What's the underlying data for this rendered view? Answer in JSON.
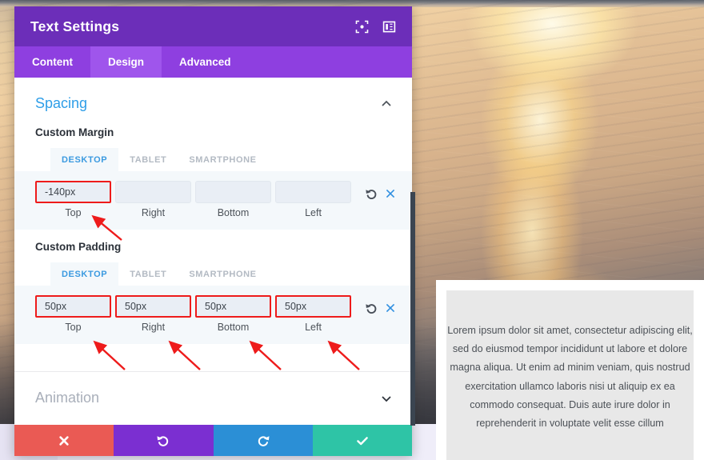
{
  "modal": {
    "title": "Text Settings",
    "header_icons": [
      {
        "name": "focus-target-icon"
      },
      {
        "name": "panel-layout-icon"
      }
    ],
    "tabs": [
      {
        "label": "Content",
        "active": false
      },
      {
        "label": "Design",
        "active": true
      },
      {
        "label": "Advanced",
        "active": false
      }
    ],
    "sections": [
      {
        "title": "Spacing",
        "expanded": true,
        "chevron": "chevron-up-icon",
        "groups": [
          {
            "label": "Custom Margin",
            "device_tabs": [
              {
                "label": "DESKTOP",
                "active": true
              },
              {
                "label": "TABLET",
                "active": false
              },
              {
                "label": "SMARTPHONE",
                "active": false
              }
            ],
            "fields": [
              {
                "value": "-140px",
                "label": "Top",
                "highlighted": true
              },
              {
                "value": "",
                "label": "Right",
                "highlighted": false
              },
              {
                "value": "",
                "label": "Bottom",
                "highlighted": false
              },
              {
                "value": "",
                "label": "Left",
                "highlighted": false
              }
            ],
            "row_icons": [
              {
                "name": "reset-icon"
              },
              {
                "name": "clear-icon"
              }
            ]
          },
          {
            "label": "Custom Padding",
            "device_tabs": [
              {
                "label": "DESKTOP",
                "active": true
              },
              {
                "label": "TABLET",
                "active": false
              },
              {
                "label": "SMARTPHONE",
                "active": false
              }
            ],
            "fields": [
              {
                "value": "50px",
                "label": "Top",
                "highlighted": true
              },
              {
                "value": "50px",
                "label": "Right",
                "highlighted": true
              },
              {
                "value": "50px",
                "label": "Bottom",
                "highlighted": true
              },
              {
                "value": "50px",
                "label": "Left",
                "highlighted": true
              }
            ],
            "row_icons": [
              {
                "name": "reset-icon"
              },
              {
                "name": "clear-icon"
              }
            ]
          }
        ]
      },
      {
        "title": "Animation",
        "expanded": false,
        "chevron": "chevron-down-icon",
        "groups": []
      }
    ],
    "action_bar": [
      {
        "name": "cancel-button",
        "icon": "close-x-icon",
        "color": "#ea5a54"
      },
      {
        "name": "undo-button",
        "icon": "undo-arrow-icon",
        "color": "#7b2fd1"
      },
      {
        "name": "redo-button",
        "icon": "redo-arrow-icon",
        "color": "#2b8fd6"
      },
      {
        "name": "save-button",
        "icon": "checkmark-icon",
        "color": "#2ec4a6"
      }
    ],
    "colors": {
      "titlebar": "#6c2eb9",
      "tabbar": "#8e3fe0",
      "tab_active": "#9f55ec",
      "section_title": "#2e9ee8",
      "section_title_collapsed": "#a9afba",
      "highlight_outline": "#ee1b1b",
      "field_bg": "#e9eef5",
      "row_bg": "#f4f8fb"
    }
  },
  "preview": {
    "paragraph": "Lorem ipsum dolor sit amet, consectetur adipiscing elit, sed do eiusmod tempor incididunt ut labore et dolore magna aliqua. Ut enim ad minim veniam, quis nostrud exercitation ullamco laboris nisi ut aliquip ex ea commodo consequat. Duis aute irure dolor in reprehenderit in voluptate velit esse cillum"
  },
  "annotations": {
    "arrow_color": "#ee1b1b",
    "count": 5,
    "targets": [
      "margin-top",
      "padding-top",
      "padding-right",
      "padding-bottom",
      "padding-left"
    ]
  },
  "background": {
    "description": "sunset-over-water-photo"
  }
}
